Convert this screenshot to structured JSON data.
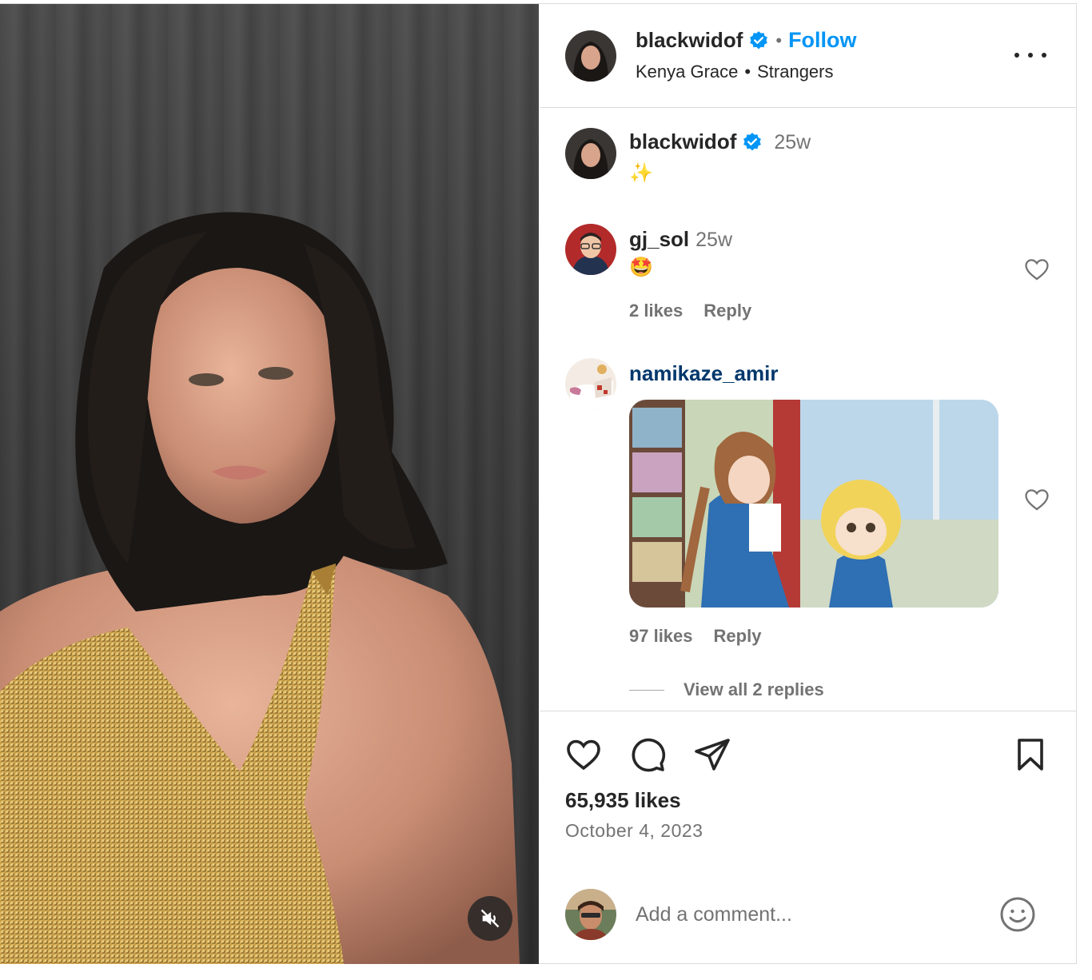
{
  "post": {
    "author": "blackwidof",
    "follow_label": "Follow",
    "separator": "•",
    "audio": {
      "artist": "Kenya Grace",
      "track": "Strangers"
    },
    "more_icon": "more-horizontal-icon",
    "media_controls": {
      "mute_icon": "speaker-muted-icon"
    }
  },
  "caption": {
    "username": "blackwidof",
    "time": "25w",
    "text": "✨"
  },
  "comments": [
    {
      "username": "gj_sol",
      "time": "25w",
      "text": "🤩",
      "likes": "2 likes",
      "reply_label": "Reply"
    },
    {
      "username": "namikaze_amir",
      "attachment": "gif",
      "likes": "97 likes",
      "reply_label": "Reply",
      "view_replies": "View all 2 replies"
    }
  ],
  "engagement": {
    "likes": "65,935 likes",
    "date": "October 4, 2023"
  },
  "composer": {
    "placeholder": "Add a comment..."
  },
  "colors": {
    "accent": "#0095f6",
    "text": "#262626",
    "secondary": "#737373",
    "border": "#dbdbdb",
    "mention_blue": "#00376b"
  }
}
